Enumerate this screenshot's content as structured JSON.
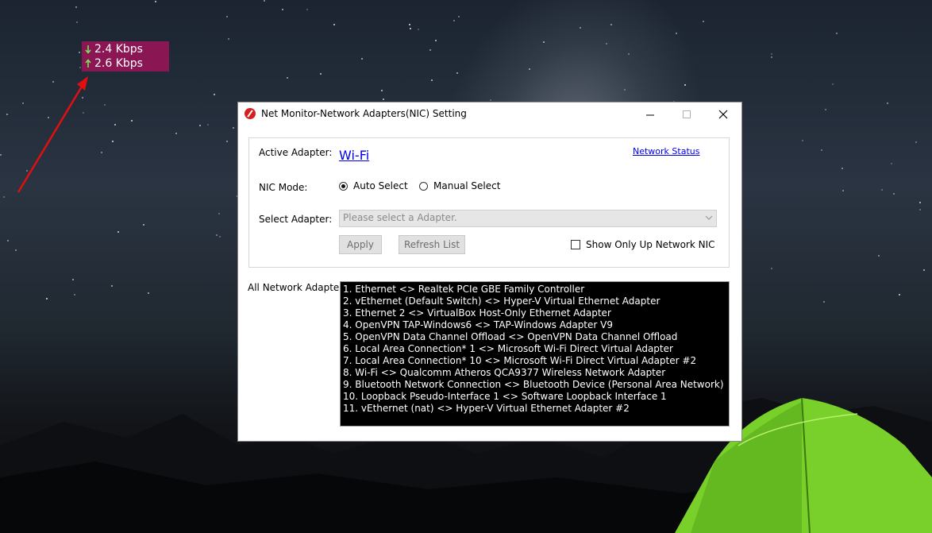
{
  "widget": {
    "download": "2.4 Kbps",
    "upload": "2.6 Kbps"
  },
  "window": {
    "title": "Net Monitor-Network Adapters(NIC) Setting",
    "minimize_glyph": "—",
    "maximize_glyph": "☐",
    "close_glyph": "✕"
  },
  "settings": {
    "active_adapter_label": "Active Adapter:",
    "active_adapter_value": "Wi-Fi",
    "network_status_link": "Network Status",
    "nic_mode_label": "NIC Mode:",
    "auto_select_label": "Auto Select",
    "manual_select_label": "Manual Select",
    "select_adapter_label": "Select Adapter:",
    "select_placeholder": "Please select a Adapter.",
    "apply_label": "Apply",
    "refresh_label": "Refresh List",
    "show_only_up_label": "Show Only Up Network NIC"
  },
  "all_adapters": {
    "label": "All Network Adapter:",
    "items": [
      "1. Ethernet <> Realtek PCIe GBE Family Controller",
      "2. vEthernet (Default Switch) <> Hyper-V Virtual Ethernet Adapter",
      "3. Ethernet 2 <> VirtualBox Host-Only Ethernet Adapter",
      "4. OpenVPN TAP-Windows6 <> TAP-Windows Adapter V9",
      "5. OpenVPN Data Channel Offload <> OpenVPN Data Channel Offload",
      "6. Local Area Connection* 1 <> Microsoft Wi-Fi Direct Virtual Adapter",
      "7. Local Area Connection* 10 <> Microsoft Wi-Fi Direct Virtual Adapter #2",
      "8. Wi-Fi <> Qualcomm Atheros QCA9377 Wireless Network Adapter",
      "9. Bluetooth Network Connection <> Bluetooth Device (Personal Area Network)",
      "10. Loopback Pseudo-Interface 1 <> Software Loopback Interface 1",
      "11. vEthernet (nat) <> Hyper-V Virtual Ethernet Adapter #2"
    ]
  },
  "colors": {
    "widget_bg": "#8a1654",
    "arrow_green": "#7ee05f",
    "annotation_red": "#e01010",
    "link_blue": "#0000ee"
  }
}
